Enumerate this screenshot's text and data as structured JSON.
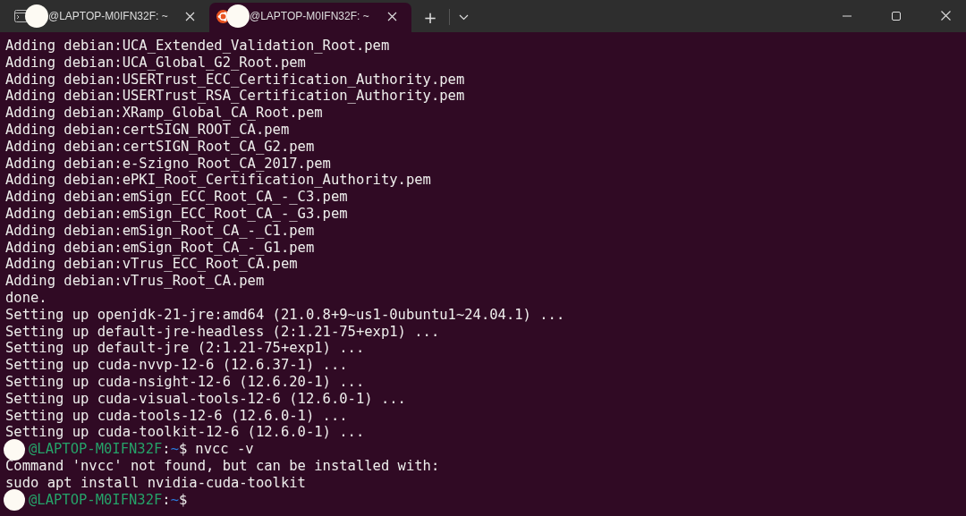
{
  "tabs": [
    {
      "title": "@LAPTOP-M0IFN32F: ~",
      "selected": false,
      "kind": "console"
    },
    {
      "title": "@LAPTOP-M0IFN32F: ~",
      "selected": true,
      "kind": "ubuntu"
    }
  ],
  "new_tab": "+",
  "lines": [
    {
      "kind": "output",
      "text": "Adding debian:UCA_Extended_Validation_Root.pem"
    },
    {
      "kind": "output",
      "text": "Adding debian:UCA_Global_G2_Root.pem"
    },
    {
      "kind": "output",
      "text": "Adding debian:USERTrust_ECC_Certification_Authority.pem"
    },
    {
      "kind": "output",
      "text": "Adding debian:USERTrust_RSA_Certification_Authority.pem"
    },
    {
      "kind": "output",
      "text": "Adding debian:XRamp_Global_CA_Root.pem"
    },
    {
      "kind": "output",
      "text": "Adding debian:certSIGN_ROOT_CA.pem"
    },
    {
      "kind": "output",
      "text": "Adding debian:certSIGN_Root_CA_G2.pem"
    },
    {
      "kind": "output",
      "text": "Adding debian:e-Szigno_Root_CA_2017.pem"
    },
    {
      "kind": "output",
      "text": "Adding debian:ePKI_Root_Certification_Authority.pem"
    },
    {
      "kind": "output",
      "text": "Adding debian:emSign_ECC_Root_CA_-_C3.pem"
    },
    {
      "kind": "output",
      "text": "Adding debian:emSign_ECC_Root_CA_-_G3.pem"
    },
    {
      "kind": "output",
      "text": "Adding debian:emSign_Root_CA_-_C1.pem"
    },
    {
      "kind": "output",
      "text": "Adding debian:emSign_Root_CA_-_G1.pem"
    },
    {
      "kind": "output",
      "text": "Adding debian:vTrus_ECC_Root_CA.pem"
    },
    {
      "kind": "output",
      "text": "Adding debian:vTrus_Root_CA.pem"
    },
    {
      "kind": "output",
      "text": "done."
    },
    {
      "kind": "output",
      "text": "Setting up openjdk-21-jre:amd64 (21.0.8+9~us1-0ubuntu1~24.04.1) ..."
    },
    {
      "kind": "output",
      "text": "Setting up default-jre-headless (2:1.21-75+exp1) ..."
    },
    {
      "kind": "output",
      "text": "Setting up default-jre (2:1.21-75+exp1) ..."
    },
    {
      "kind": "output",
      "text": "Setting up cuda-nvvp-12-6 (12.6.37-1) ..."
    },
    {
      "kind": "output",
      "text": "Setting up cuda-nsight-12-6 (12.6.20-1) ..."
    },
    {
      "kind": "output",
      "text": "Setting up cuda-visual-tools-12-6 (12.6.0-1) ..."
    },
    {
      "kind": "output",
      "text": "Setting up cuda-tools-12-6 (12.6.0-1) ..."
    },
    {
      "kind": "output",
      "text": "Setting up cuda-toolkit-12-6 (12.6.0-1) ..."
    },
    {
      "kind": "prompt",
      "host": "@LAPTOP-M0IFN32F",
      "sep": ":",
      "path": "~",
      "sign": "$",
      "command": "nvcc -v"
    },
    {
      "kind": "output",
      "text": "Command 'nvcc' not found, but can be installed with:"
    },
    {
      "kind": "output",
      "text": "sudo apt install nvidia-cuda-toolkit"
    },
    {
      "kind": "prompt",
      "host": "@LAPTOP-M0IFN32F",
      "sep": ":",
      "path": "~",
      "sign": "$"
    }
  ]
}
